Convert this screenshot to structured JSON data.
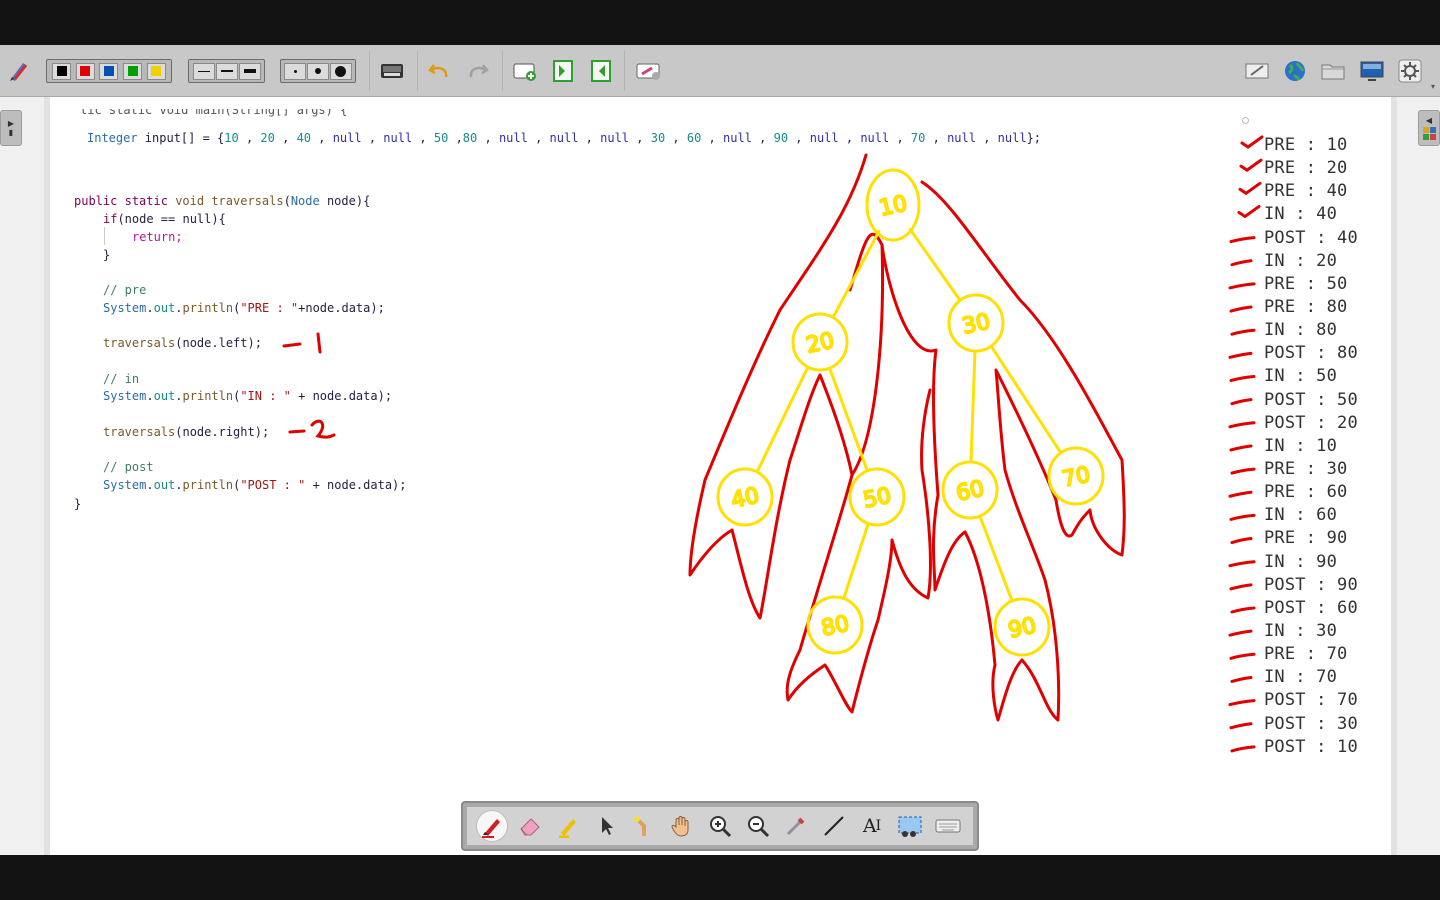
{
  "toolbar": {
    "colors": [
      "#000000",
      "#e00000",
      "#0050b0",
      "#00a000",
      "#f0d000"
    ],
    "accent_color": "#e00000"
  },
  "code": {
    "partial_top": "lic static void main(String[] args) {",
    "input_line": {
      "prefix": "Integer input[] = {",
      "values": [
        "10",
        "20",
        "40",
        "null",
        "null",
        "50",
        "80",
        "null",
        "null",
        "null",
        "30",
        "60",
        "null",
        "90",
        "null",
        "null",
        "70",
        "null",
        "null"
      ],
      "suffix": "};"
    },
    "method_sig": {
      "public": "public",
      "static": "static",
      "void": "void",
      "name": "traversals",
      "param_type": "Node",
      "param_name": "node"
    },
    "lines": {
      "if_kw": "if",
      "if_cond": "(node == null){",
      "return_kw": "return;",
      "close_brace": "}",
      "comment_pre": "// pre",
      "comment_in": "// in",
      "comment_post": "// post",
      "system": "System",
      "out": "out",
      "println": "println",
      "pre_str": "\"PRE : \"",
      "pre_tail": "+node.data);",
      "in_str": "\"IN : \"",
      "in_tail": " + node.data);",
      "post_str": "\"POST : \"",
      "post_tail": " + node.data);",
      "trav_left_args": "(node.left);",
      "trav_right_args": "(node.right);",
      "end_brace": "}"
    }
  },
  "annotations": {
    "left_call_mark": "1",
    "right_call_mark": "2"
  },
  "tree": {
    "nodes": [
      {
        "label": "10",
        "children": [
          "20",
          "30"
        ]
      },
      {
        "label": "20",
        "children": [
          "40",
          "50"
        ]
      },
      {
        "label": "30",
        "children": [
          "60",
          "70"
        ]
      },
      {
        "label": "40",
        "children": []
      },
      {
        "label": "50",
        "children": [
          "80"
        ]
      },
      {
        "label": "60",
        "children": [
          "90"
        ]
      },
      {
        "label": "70",
        "children": []
      },
      {
        "label": "80",
        "children": []
      },
      {
        "label": "90",
        "children": []
      }
    ],
    "node_color": "#ffe000",
    "path_color": "#e00000"
  },
  "output": [
    "PRE : 10",
    "PRE : 20",
    "PRE : 40",
    "IN : 40",
    "POST : 40",
    "IN : 20",
    "PRE : 50",
    "PRE : 80",
    "IN : 80",
    "POST : 80",
    "IN : 50",
    "POST : 50",
    "POST : 20",
    "IN : 10",
    "PRE : 30",
    "PRE : 60",
    "IN : 60",
    "PRE : 90",
    "IN : 90",
    "POST : 90",
    "POST : 60",
    "IN : 30",
    "PRE : 70",
    "IN : 70",
    "POST : 70",
    "POST : 30",
    "POST : 10"
  ],
  "dock": {
    "tools": [
      "pen-icon",
      "eraser-icon",
      "highlighter-icon",
      "pointer-icon",
      "laser-icon",
      "hand-icon",
      "zoom-in-icon",
      "zoom-out-icon",
      "color-picker-icon",
      "line-icon",
      "text-icon",
      "screenshot-icon",
      "keyboard-icon"
    ],
    "text_tool_label": "A"
  }
}
